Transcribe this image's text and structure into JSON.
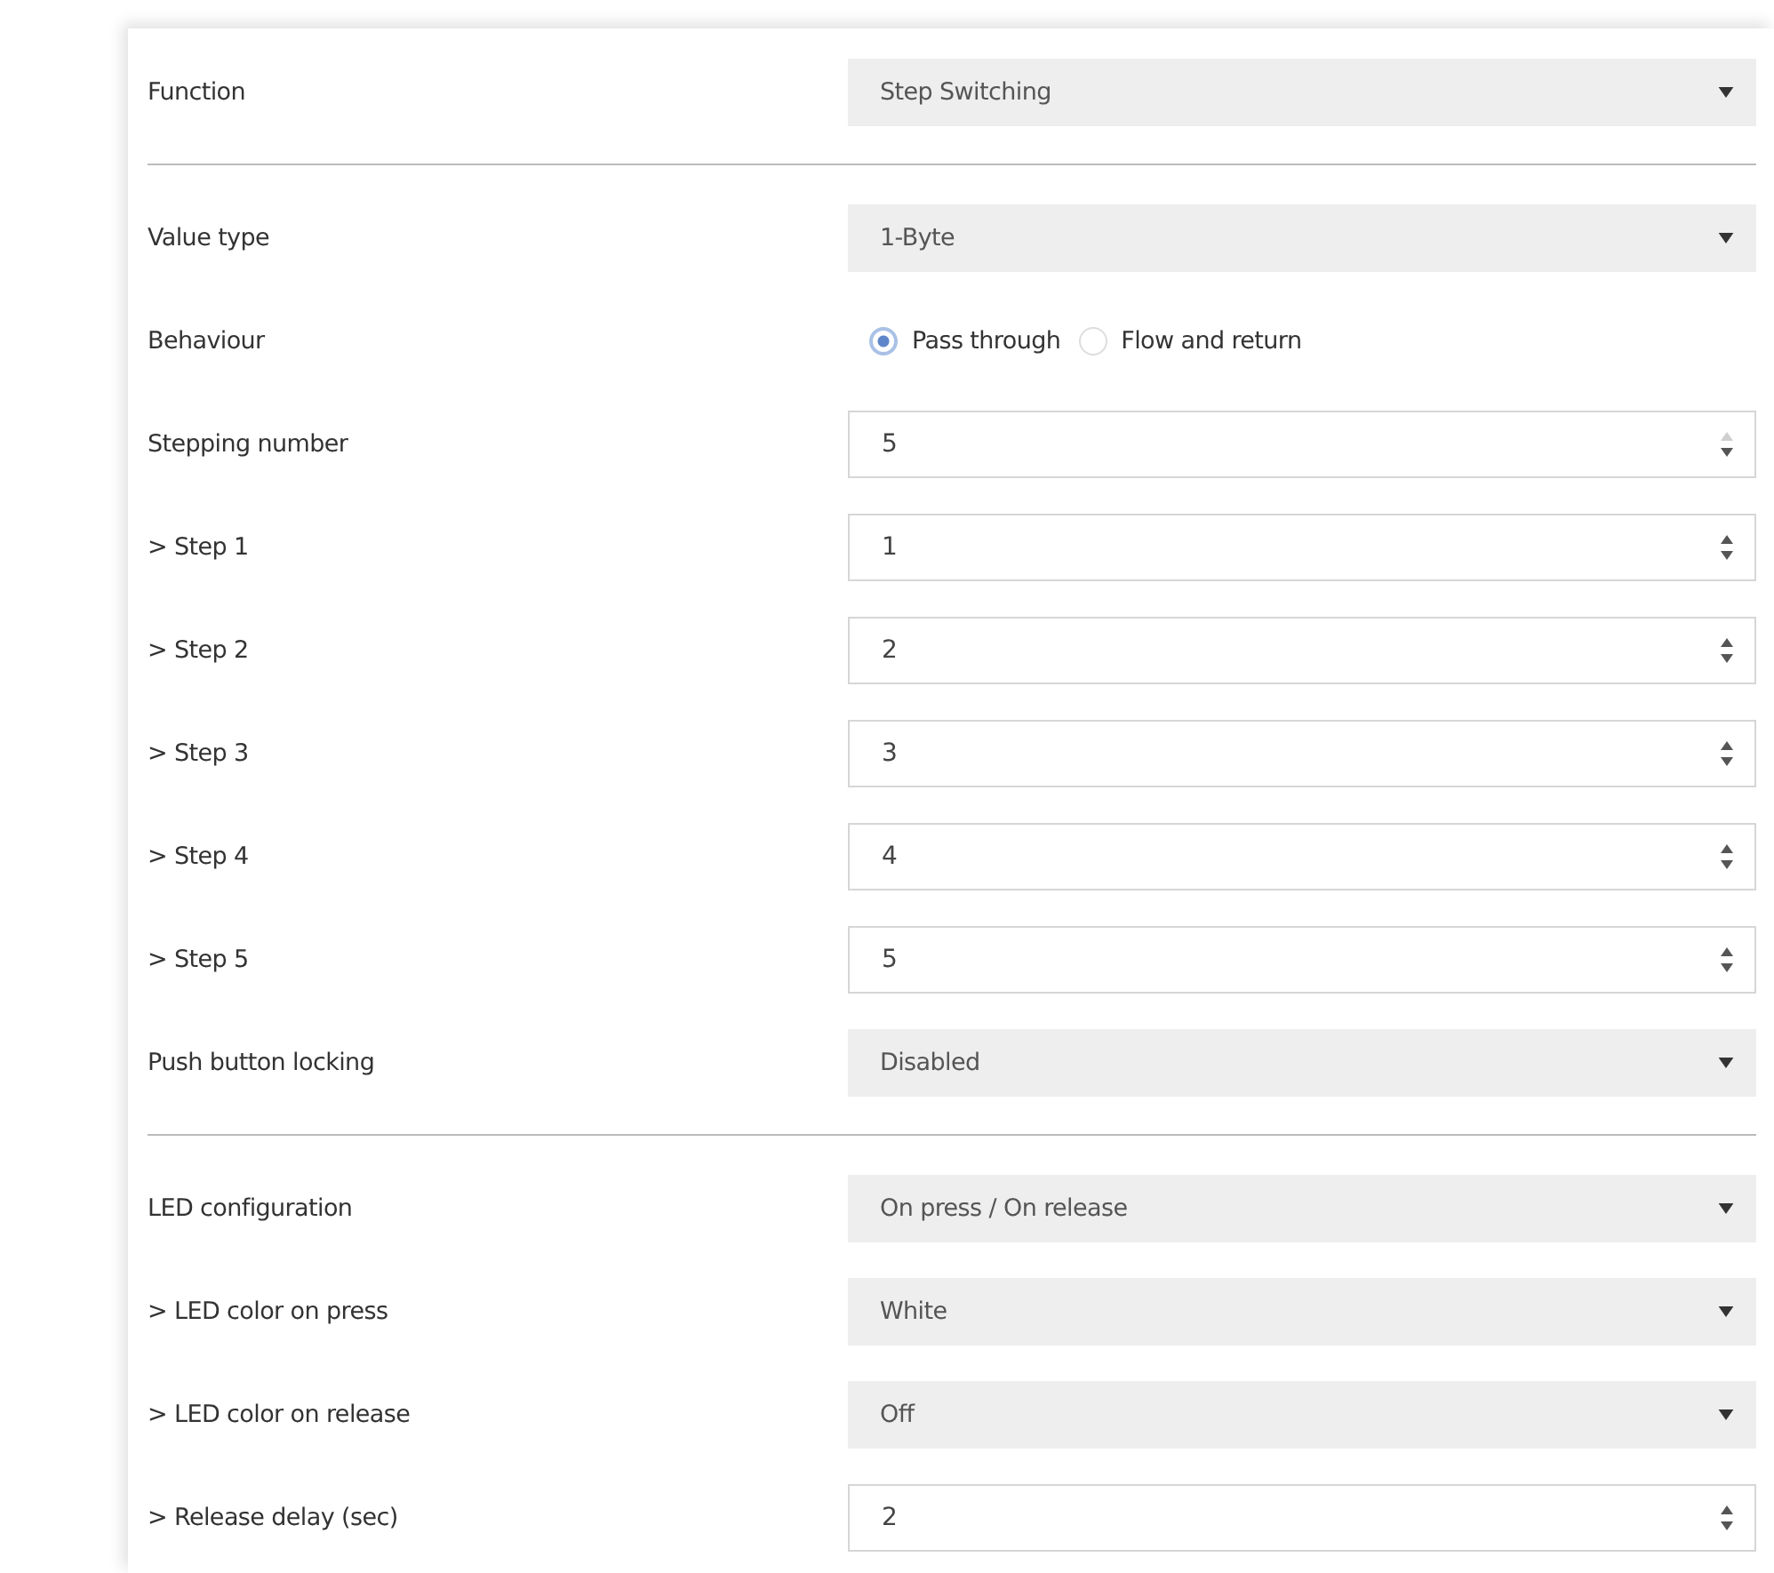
{
  "rows": [
    {
      "kind": "select",
      "label": "Function",
      "value": "Step Switching"
    },
    {
      "kind": "divider"
    },
    {
      "kind": "select",
      "label": "Value type",
      "value": "1-Byte"
    },
    {
      "kind": "radio",
      "label": "Behaviour",
      "options": [
        {
          "label": "Pass through",
          "selected": true
        },
        {
          "label": "Flow and return",
          "selected": false
        }
      ]
    },
    {
      "kind": "spinner",
      "label": "Stepping number",
      "value": "5",
      "up_disabled": true
    },
    {
      "kind": "spinner",
      "label": "> Step 1",
      "value": "1",
      "up_disabled": false
    },
    {
      "kind": "spinner",
      "label": "> Step 2",
      "value": "2",
      "up_disabled": false
    },
    {
      "kind": "spinner",
      "label": "> Step 3",
      "value": "3",
      "up_disabled": false
    },
    {
      "kind": "spinner",
      "label": "> Step 4",
      "value": "4",
      "up_disabled": false
    },
    {
      "kind": "spinner",
      "label": "> Step 5",
      "value": "5",
      "up_disabled": false
    },
    {
      "kind": "select",
      "label": "Push button locking",
      "value": "Disabled"
    },
    {
      "kind": "divider"
    },
    {
      "kind": "select",
      "label": "LED configuration",
      "value": "On press / On release"
    },
    {
      "kind": "select",
      "label": "> LED color on press",
      "value": "White"
    },
    {
      "kind": "select",
      "label": "> LED color on release",
      "value": "Off"
    },
    {
      "kind": "spinner",
      "label": "> Release delay (sec)",
      "value": "2",
      "up_disabled": false
    }
  ]
}
